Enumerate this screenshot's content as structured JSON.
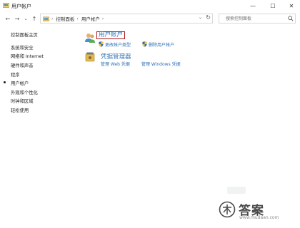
{
  "window": {
    "title": "用户帐户",
    "minimize_symbol": "—",
    "maximize_symbol": "☐",
    "close_symbol": "✕"
  },
  "nav": {
    "back_symbol": "←",
    "forward_symbol": "→",
    "recent_symbol": "⌄",
    "up_symbol": "↑"
  },
  "address": {
    "breadcrumbs": [
      "控制面板",
      "用户帐户"
    ],
    "separator": "›",
    "dropdown_symbol": "⌄",
    "refresh_symbol": "↻"
  },
  "search": {
    "placeholder": "搜索控制面板"
  },
  "sidebar": {
    "items": [
      {
        "label": "控制面板主页"
      },
      {
        "label": "系统和安全"
      },
      {
        "label": "网络和 Internet"
      },
      {
        "label": "硬件和声音"
      },
      {
        "label": "程序"
      },
      {
        "label": "用户帐户"
      },
      {
        "label": "外观和个性化"
      },
      {
        "label": "时钟和区域"
      },
      {
        "label": "轻松使用"
      }
    ],
    "current_index": 5
  },
  "main": {
    "categories": [
      {
        "title": "用户帐户",
        "icon": "user-accounts-icon",
        "tasks": [
          "更改帐户类型",
          "删除用户帐户"
        ]
      },
      {
        "title": "凭据管理器",
        "icon": "credential-manager-icon",
        "tasks": [
          "管理 Web 凭据",
          "管理 Windows 凭据"
        ]
      }
    ]
  },
  "watermark": {
    "text": "答案",
    "url": "www.mudaan.com"
  },
  "colors": {
    "link": "#2e6fb6",
    "category_title": "#3a76b8",
    "highlight_border": "#b0191e"
  }
}
